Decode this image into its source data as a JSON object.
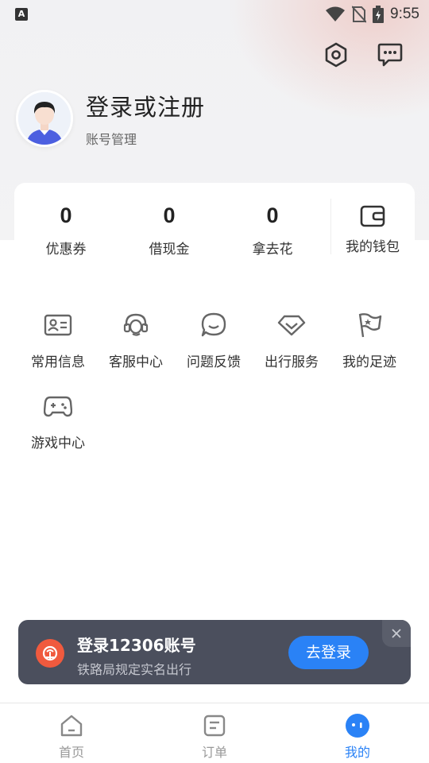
{
  "status_bar": {
    "time": "9:55",
    "app_icon": "A"
  },
  "header": {
    "settings_icon": "gear-icon",
    "message_icon": "chat-icon"
  },
  "profile": {
    "title": "登录或注册",
    "subtitle": "账号管理"
  },
  "wallet": {
    "stats": [
      {
        "value": "0",
        "label": "优惠券"
      },
      {
        "value": "0",
        "label": "借现金"
      },
      {
        "value": "0",
        "label": "拿去花"
      }
    ],
    "wallet_label": "我的钱包"
  },
  "services": [
    {
      "label": "常用信息",
      "icon": "id-card-icon"
    },
    {
      "label": "客服中心",
      "icon": "headset-icon"
    },
    {
      "label": "问题反馈",
      "icon": "feedback-icon"
    },
    {
      "label": "出行服务",
      "icon": "diamond-icon"
    },
    {
      "label": "我的足迹",
      "icon": "flag-icon"
    },
    {
      "label": "游戏中心",
      "icon": "gamepad-icon"
    }
  ],
  "login_banner": {
    "title": "登录12306账号",
    "subtitle": "铁路局规定实名出行",
    "button": "去登录"
  },
  "tabs": [
    {
      "label": "首页",
      "icon": "home-icon",
      "active": false
    },
    {
      "label": "订单",
      "icon": "order-icon",
      "active": false
    },
    {
      "label": "我的",
      "icon": "profile-icon",
      "active": true
    }
  ],
  "colors": {
    "accent": "#2a82f6",
    "banner": "#4b4f5d",
    "logo": "#f05a3e"
  }
}
